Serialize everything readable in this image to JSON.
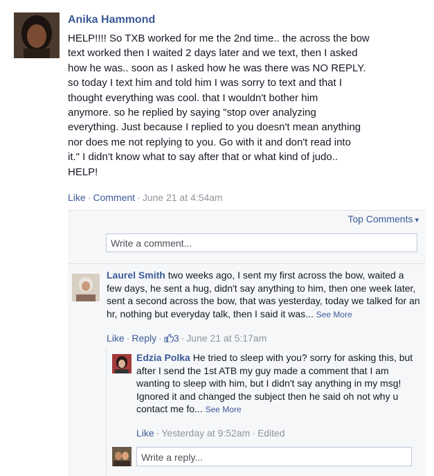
{
  "post": {
    "author": "Anika Hammond",
    "body": "HELP!!!! So TXB worked for me the 2nd time.. the across the bow\ntext worked then I waited 2 days later and we text, then I asked\nhow he was.. soon as I asked how he was there was NO REPLY.\nso today I text him and told him I was sorry to text and that I\nthought everything was cool. that I wouldn't bother him\nanymore. so he replied by saying \"stop over analyzing\neverything. Just because I replied to you doesn't mean anything\nnor does me not replying to you. Go with it and don't read into\nit.\" I didn't know what to say after that or what kind of judo..\nHELP!",
    "actions": {
      "like": "Like",
      "comment": "Comment",
      "timestamp": "June 21 at 4:54am"
    }
  },
  "comments_header": {
    "sort_label": "Top Comments"
  },
  "comment_input": {
    "placeholder": "Write a comment..."
  },
  "comment": {
    "author": "Laurel Smith",
    "text": "two weeks ago, I sent my first across the bow, waited a few days, he sent a hug, didn't say anything to him, then one week later, sent a second across the bow, that was yesterday, today we talked for an hr, nothing but everyday talk, then I said it was...",
    "see_more": "See More",
    "actions": {
      "like": "Like",
      "reply": "Reply",
      "like_count": "3",
      "timestamp": "June 21 at 5:17am"
    }
  },
  "reply": {
    "author": "Edzia Polka",
    "text": "He tried to sleep with you? sorry for asking this, but after I send the 1st ATB my guy made a comment that I am wanting to sleep with him, but I didn't say anything in my msg! Ignored it and changed the subject then he said oh not why u contact me fo...",
    "see_more": "See More",
    "actions": {
      "like": "Like",
      "timestamp": "Yesterday at 9:52am",
      "edited": "Edited"
    }
  },
  "reply_input": {
    "placeholder": "Write a reply..."
  },
  "icons": {
    "like_count_icon": "thumbs-up-icon",
    "sort_caret": "caret-down-icon"
  },
  "colors": {
    "link": "#3b5998",
    "muted": "#90949c",
    "comments_bg": "#f6f7f9"
  }
}
